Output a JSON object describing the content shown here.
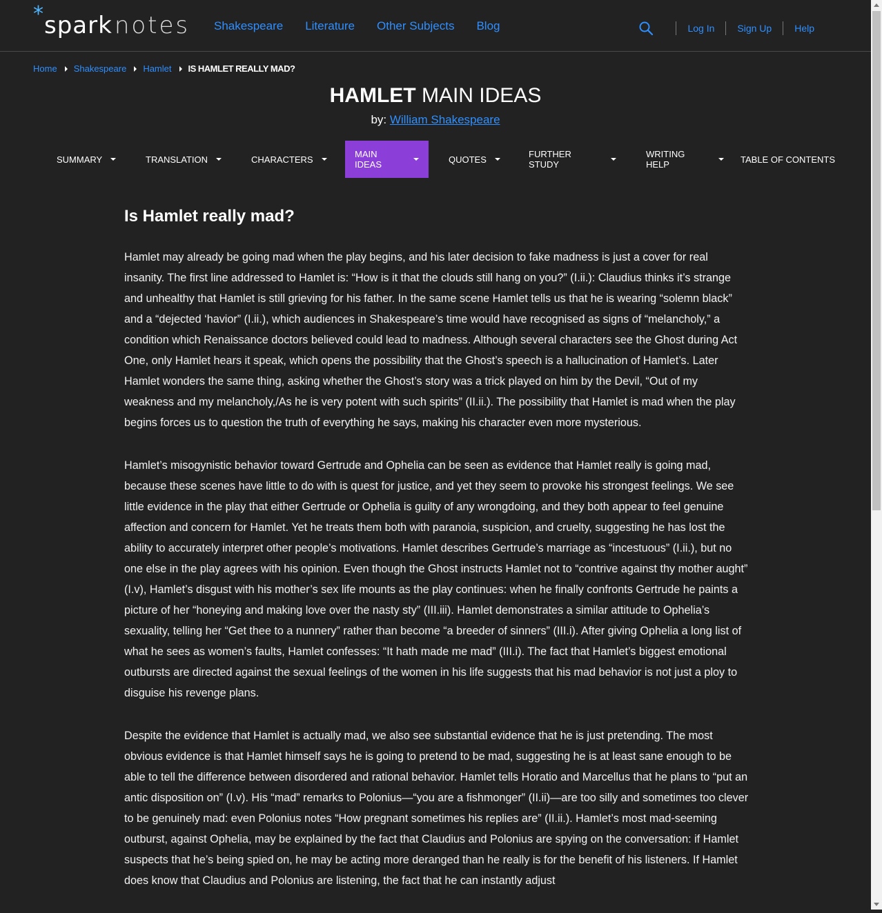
{
  "header": {
    "logo": {
      "star": "*",
      "spark": "spark",
      "notes": "notes"
    },
    "nav": [
      {
        "label": "Shakespeare"
      },
      {
        "label": "Literature"
      },
      {
        "label": "Other Subjects"
      },
      {
        "label": "Blog"
      }
    ],
    "utility": {
      "login": "Log In",
      "signup": "Sign Up",
      "help": "Help"
    }
  },
  "breadcrumb": {
    "home": "Home",
    "shakespeare": "Shakespeare",
    "hamlet": "Hamlet",
    "current": "IS HAMLET REALLY MAD?"
  },
  "title": {
    "bold": "HAMLET",
    "light": "MAIN IDEAS"
  },
  "byline": {
    "prefix": "by:",
    "author": "William Shakespeare"
  },
  "tabs": [
    {
      "label": "SUMMARY"
    },
    {
      "label": "TRANSLATION"
    },
    {
      "label": "CHARACTERS"
    },
    {
      "label": "MAIN IDEAS"
    },
    {
      "label": "QUOTES"
    },
    {
      "label": "FURTHER STUDY"
    },
    {
      "label": "WRITING HELP"
    },
    {
      "label": "TABLE OF CONTENTS"
    }
  ],
  "article": {
    "heading": "Is Hamlet really mad?",
    "paragraphs": [
      "Hamlet may already be going mad when the play begins, and his later decision to fake madness is just a cover for real insanity. The first line addressed to Hamlet is: “How is it that the clouds still hang on you?” (I.ii.): Claudius thinks it’s strange and unhealthy that Hamlet is still grieving for his father. In the same scene Hamlet tells us that he is wearing “solemn black” and a “dejected ‘havior” (I.ii.), which audiences in Shakespeare’s time would have recognised as signs of “melancholy,” a condition which Renaissance doctors believed could lead to madness. Although several characters see the Ghost during Act One, only Hamlet hears it speak, which opens the possibility that the Ghost’s speech is a hallucination of Hamlet’s. Later Hamlet wonders the same thing, asking whether the Ghost’s story was a trick played on him by the Devil, “Out of my weakness and my melancholy,/As he is very potent with such spirits” (II.ii.). The possibility that Hamlet is mad when the play begins forces us to question the truth of everything he says, making his character even more mysterious.",
      "Hamlet’s misogynistic behavior toward Gertrude and Ophelia can be seen as evidence that Hamlet really is going mad, because these scenes have little to do with is quest for justice, and yet they seem to provoke his strongest feelings. We see little evidence in the play that either Gertrude or Ophelia is guilty of any wrongdoing, and they both appear to feel genuine affection and concern for Hamlet. Yet he treats them both with paranoia, suspicion, and cruelty, suggesting he has lost the ability to accurately interpret other people’s motivations. Hamlet describes Gertrude’s marriage as “incestuous” (I.ii.), but no one else in the play agrees with his opinion. Even though the Ghost instructs Hamlet not to “contrive against thy mother aught” (I.v), Hamlet’s disgust with his mother’s sex life mounts as the play continues: when he finally confronts Gertrude he paints a picture of her “honeying and making love over the nasty sty” (III.iii). Hamlet demonstrates a similar attitude to Ophelia’s sexuality, telling her “Get thee to a nunnery” rather than become “a breeder of sinners” (III.i). After giving Ophelia a long list of what he sees as women’s faults, Hamlet confesses: “It hath made me mad” (III.i). The fact that Hamlet’s biggest emotional outbursts are directed against the sexual feelings of the women in his life suggests that his mad behavior is not just a ploy to disguise his revenge plans.",
      "Despite the evidence that Hamlet is actually mad, we also see substantial evidence that he is just pretending. The most obvious evidence is that Hamlet himself says he is going to pretend to be mad, suggesting he is at least sane enough to be able to tell the difference between disordered and rational behavior. Hamlet tells Horatio and Marcellus that he plans to “put an antic disposition on” (I.v). His “mad” remarks to Polonius—“you are a fishmonger” (II.ii)—are too silly and sometimes too clever to be genuinely mad: even Polonius notes “How pregnant sometimes his replies are” (II.ii.). Hamlet’s most mad-seeming outburst, against Ophelia, may be explained by the fact that Claudius and Polonius are spying on the conversation: if Hamlet suspects that he’s being spied on, he may be acting more deranged than he really is for the benefit of his listeners. If Hamlet does know that Claudius and Polonius are listening, the fact that he can instantly adjust"
    ]
  },
  "colors": {
    "background": "#222222",
    "link": "#2f8fff",
    "active_tab": "#8c3fd8",
    "logo_star": "#4fb5ff"
  },
  "icons": {
    "search": "search-icon"
  }
}
